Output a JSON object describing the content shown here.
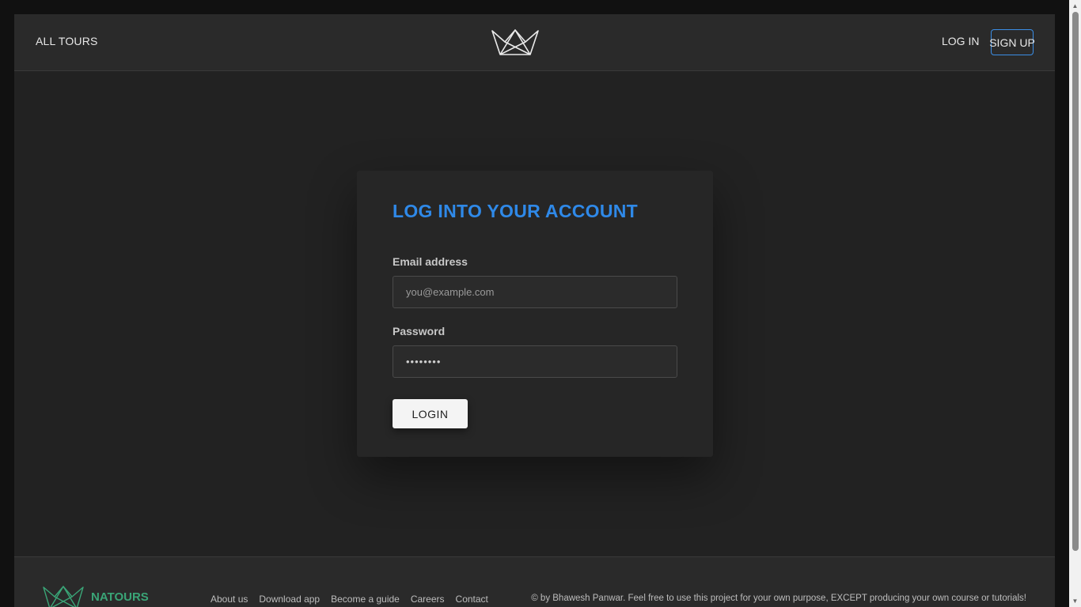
{
  "header": {
    "all_tours": "ALL TOURS",
    "login": "LOG IN",
    "signup": "SIGN UP",
    "logo_icon": "natours-crown-icon"
  },
  "login_form": {
    "title": "LOG INTO YOUR ACCOUNT",
    "email_label": "Email address",
    "email_placeholder": "you@example.com",
    "password_label": "Password",
    "password_value": "••••••••",
    "submit_label": "LOGIN"
  },
  "footer": {
    "brand": "NATOURS",
    "links": [
      "About us",
      "Download app",
      "Become a guide",
      "Careers",
      "Contact"
    ],
    "copyright": "© by Bhawesh Panwar. Feel free to use this project for your own purpose, EXCEPT producing your own course or tutorials!"
  },
  "colors": {
    "accent_blue": "#2f89e8",
    "brand_green": "#3aa577",
    "background": "#222222"
  }
}
